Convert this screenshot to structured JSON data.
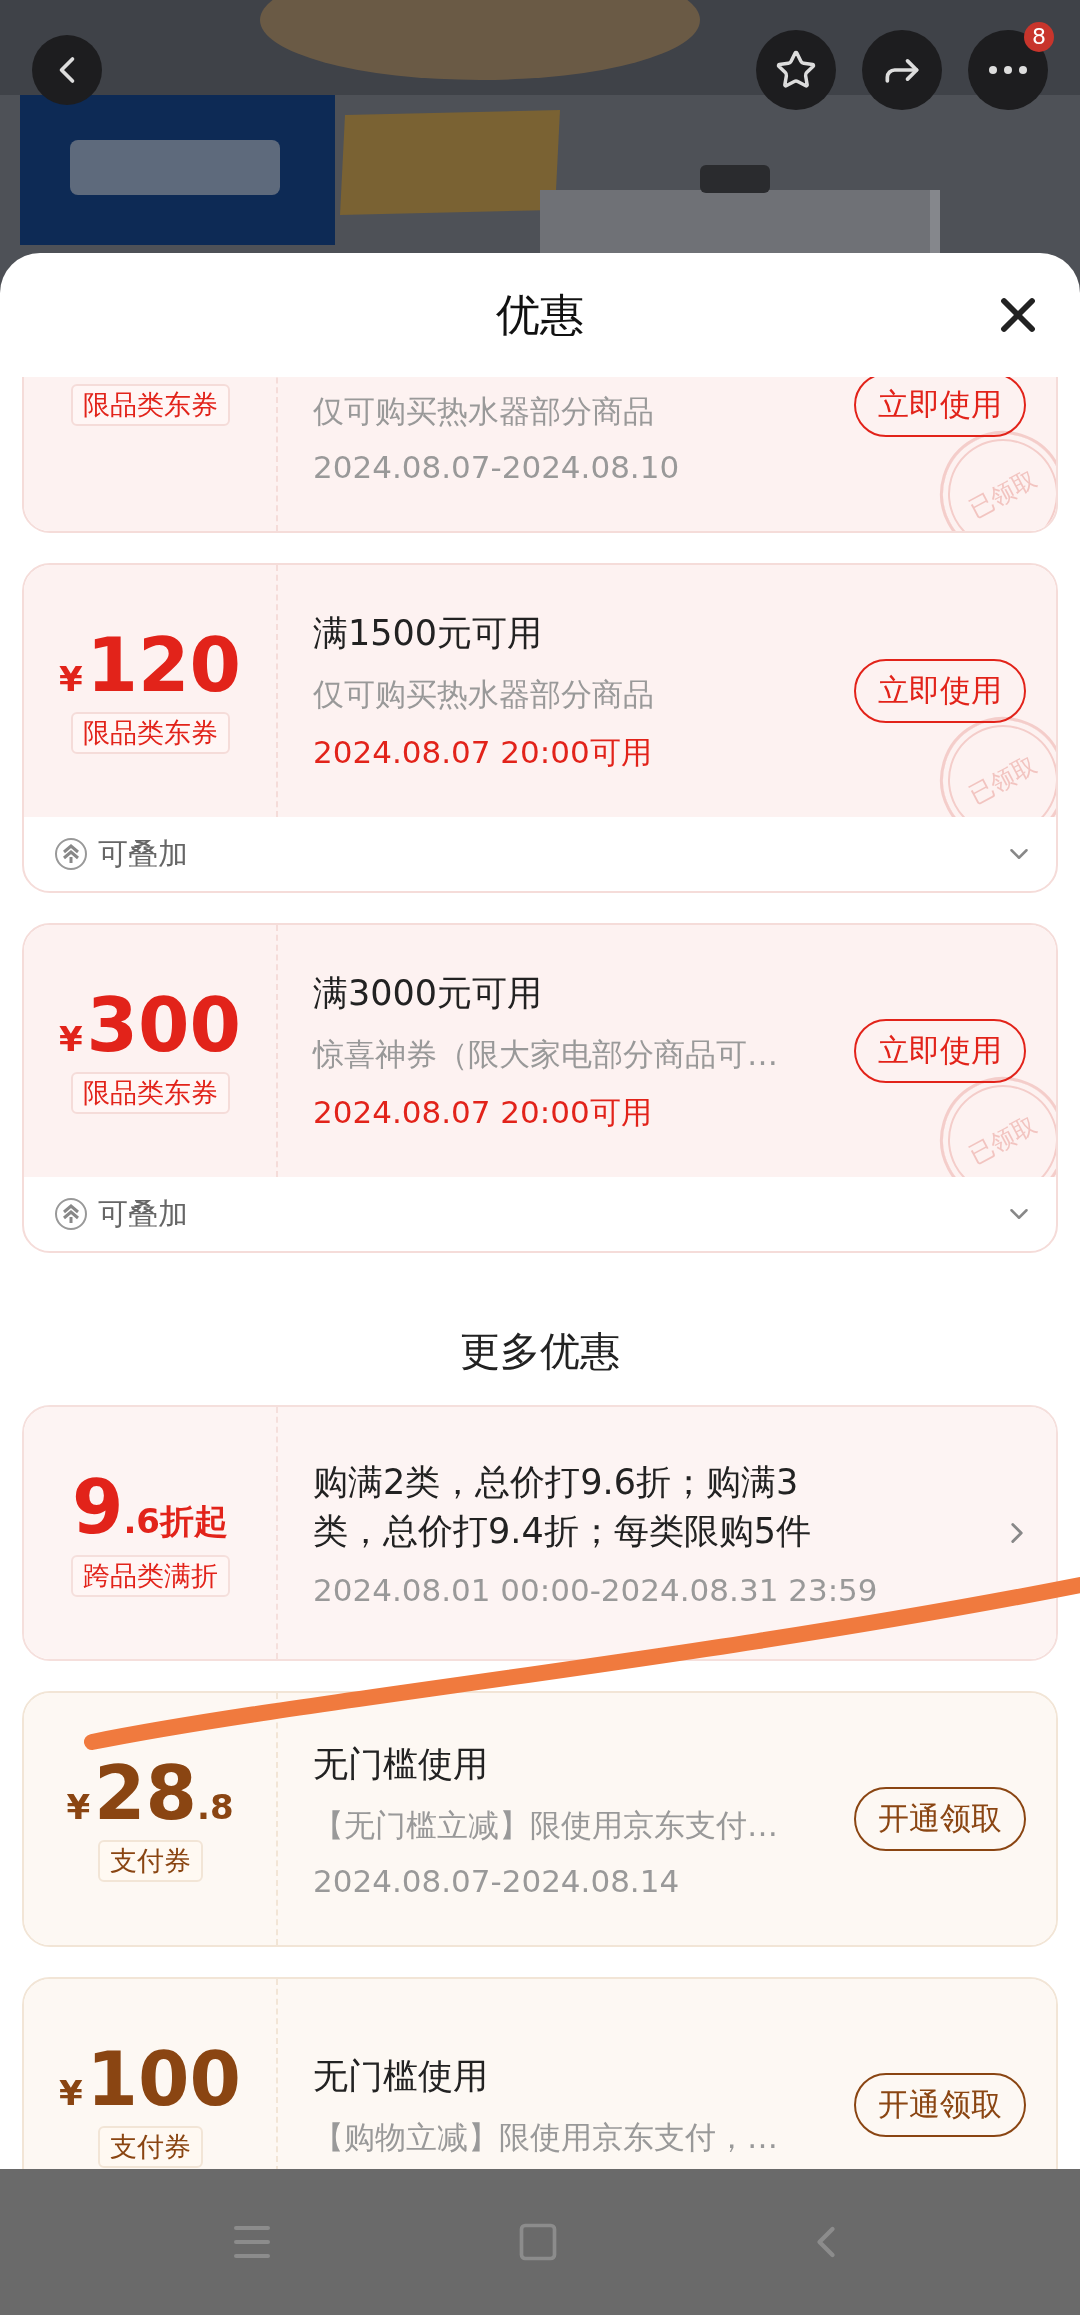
{
  "top_bar": {
    "more_badge": "8"
  },
  "sheet": {
    "title": "优惠"
  },
  "coupons": [
    {
      "kind": "jd",
      "tag": "限品类东券",
      "desc": "仅可购买热水器部分商品",
      "date": "2024.08.07-2024.08.10",
      "date_highlight": false,
      "action": {
        "kind": "button",
        "label": "立即使用"
      },
      "stamp": "已领取"
    },
    {
      "kind": "jd",
      "amount": {
        "currency": "¥",
        "main": "120"
      },
      "tag": "限品类东券",
      "title": "满1500元可用",
      "desc": "仅可购买热水器部分商品",
      "date": "2024.08.07 20:00可用",
      "date_highlight": true,
      "action": {
        "kind": "button",
        "label": "立即使用"
      },
      "stamp": "已领取",
      "footer": {
        "label": "可叠加"
      }
    },
    {
      "kind": "jd",
      "amount": {
        "currency": "¥",
        "main": "300"
      },
      "tag": "限品类东券",
      "title": "满3000元可用",
      "desc": "惊喜神券（限大家电部分商品可…",
      "date": "2024.08.07 20:00可用",
      "date_highlight": true,
      "action": {
        "kind": "button",
        "label": "立即使用"
      },
      "stamp": "已领取",
      "footer": {
        "label": "可叠加"
      }
    }
  ],
  "more_title": "更多优惠",
  "more_coupons": [
    {
      "kind": "discount",
      "amount": {
        "main": "9",
        "minor": ".6折起"
      },
      "tag": "跨品类满折",
      "title": "购满2类，总价打9.6折；购满3类，总价打9.4折；每类限购5件",
      "date": "2024.08.01 00:00-2024.08.31 23:59",
      "date_highlight": false,
      "action": {
        "kind": "chevron"
      }
    },
    {
      "kind": "pay",
      "amount": {
        "currency": "¥",
        "main": "28",
        "minor": ".8"
      },
      "tag": "支付券",
      "title": "无门槛使用",
      "desc": "【无门槛立减】限使用京东支付…",
      "date": "2024.08.07-2024.08.14",
      "date_highlight": false,
      "action": {
        "kind": "button",
        "label": "开通领取"
      }
    },
    {
      "kind": "pay",
      "amount": {
        "currency": "¥",
        "main": "100"
      },
      "tag": "支付券",
      "title": "无门槛使用",
      "desc": "【购物立减】限使用京东支付，…",
      "action": {
        "kind": "button",
        "label": "开通领取"
      }
    }
  ]
}
